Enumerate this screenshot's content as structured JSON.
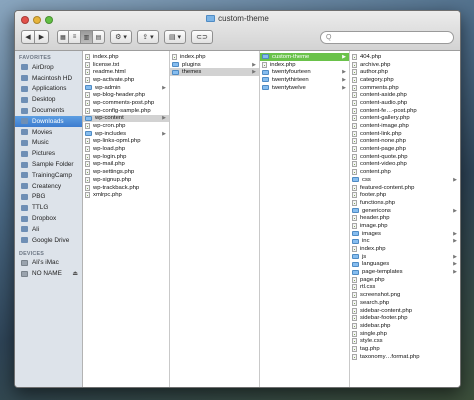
{
  "window": {
    "title": "custom-theme"
  },
  "toolbar": {
    "back_label": "◀",
    "forward_label": "▶",
    "view_labels": [
      "▦",
      "≡",
      "▥",
      "▤"
    ],
    "action_label": "⚙ ▾",
    "share_label": "⇪ ▾",
    "arrange_label": "▤ ▾",
    "tag_label": "⊂⊃",
    "search_placeholder": "Q"
  },
  "sidebar": {
    "favorites_header": "FAVORITES",
    "favorites": [
      {
        "label": "AirDrop"
      },
      {
        "label": "Macintosh HD"
      },
      {
        "label": "Applications"
      },
      {
        "label": "Desktop"
      },
      {
        "label": "Documents"
      },
      {
        "label": "Downloads"
      },
      {
        "label": "Movies"
      },
      {
        "label": "Music"
      },
      {
        "label": "Pictures"
      },
      {
        "label": "Sample Folder"
      },
      {
        "label": "TrainingCamp"
      },
      {
        "label": "Creatency"
      },
      {
        "label": "PBG"
      },
      {
        "label": "TTLG"
      },
      {
        "label": "Dropbox"
      },
      {
        "label": "Ali"
      },
      {
        "label": "Google Drive"
      }
    ],
    "devices_header": "DEVICES",
    "devices": [
      {
        "label": "Ali's iMac"
      },
      {
        "label": "NO NAME"
      }
    ],
    "eject_label": "⏏",
    "selected_color": "#3d7ccf"
  },
  "columns": {
    "col1": [
      {
        "label": "index.php"
      },
      {
        "label": "license.txt"
      },
      {
        "label": "readme.html"
      },
      {
        "label": "wp-activate.php"
      },
      {
        "label": "wp-admin"
      },
      {
        "label": "wp-blog-header.php"
      },
      {
        "label": "wp-comments-post.php"
      },
      {
        "label": "wp-config-sample.php"
      },
      {
        "label": "wp-content"
      },
      {
        "label": "wp-cron.php"
      },
      {
        "label": "wp-includes"
      },
      {
        "label": "wp-links-opml.php"
      },
      {
        "label": "wp-load.php"
      },
      {
        "label": "wp-login.php"
      },
      {
        "label": "wp-mail.php"
      },
      {
        "label": "wp-settings.php"
      },
      {
        "label": "wp-signup.php"
      },
      {
        "label": "wp-trackback.php"
      },
      {
        "label": "xmlrpc.php"
      }
    ],
    "col2": [
      {
        "label": "index.php"
      },
      {
        "label": "plugins"
      },
      {
        "label": "themes"
      }
    ],
    "col3": [
      {
        "label": "custom-theme"
      },
      {
        "label": "index.php"
      },
      {
        "label": "twentyfourteen"
      },
      {
        "label": "twentythirteen"
      },
      {
        "label": "twentytwelve"
      }
    ],
    "col4": [
      {
        "label": "404.php"
      },
      {
        "label": "archive.php"
      },
      {
        "label": "author.php"
      },
      {
        "label": "category.php"
      },
      {
        "label": "comments.php"
      },
      {
        "label": "content-aside.php"
      },
      {
        "label": "content-audio.php"
      },
      {
        "label": "content-fe…-post.php"
      },
      {
        "label": "content-gallery.php"
      },
      {
        "label": "content-image.php"
      },
      {
        "label": "content-link.php"
      },
      {
        "label": "content-none.php"
      },
      {
        "label": "content-page.php"
      },
      {
        "label": "content-quote.php"
      },
      {
        "label": "content-video.php"
      },
      {
        "label": "content.php"
      },
      {
        "label": "css"
      },
      {
        "label": "featured-content.php"
      },
      {
        "label": "footer.php"
      },
      {
        "label": "functions.php"
      },
      {
        "label": "genericons"
      },
      {
        "label": "header.php"
      },
      {
        "label": "image.php"
      },
      {
        "label": "images"
      },
      {
        "label": "inc"
      },
      {
        "label": "index.php"
      },
      {
        "label": "js"
      },
      {
        "label": "languages"
      },
      {
        "label": "page-templates"
      },
      {
        "label": "page.php"
      },
      {
        "label": "rtl.css"
      },
      {
        "label": "screenshot.png"
      },
      {
        "label": "search.php"
      },
      {
        "label": "sidebar-content.php"
      },
      {
        "label": "sidebar-footer.php"
      },
      {
        "label": "sidebar.php"
      },
      {
        "label": "single.php"
      },
      {
        "label": "style.css"
      },
      {
        "label": "tag.php"
      },
      {
        "label": "taxonomy…format.php"
      }
    ]
  },
  "arrow_glyph": "▶",
  "highlight_color": "#6ac24a"
}
